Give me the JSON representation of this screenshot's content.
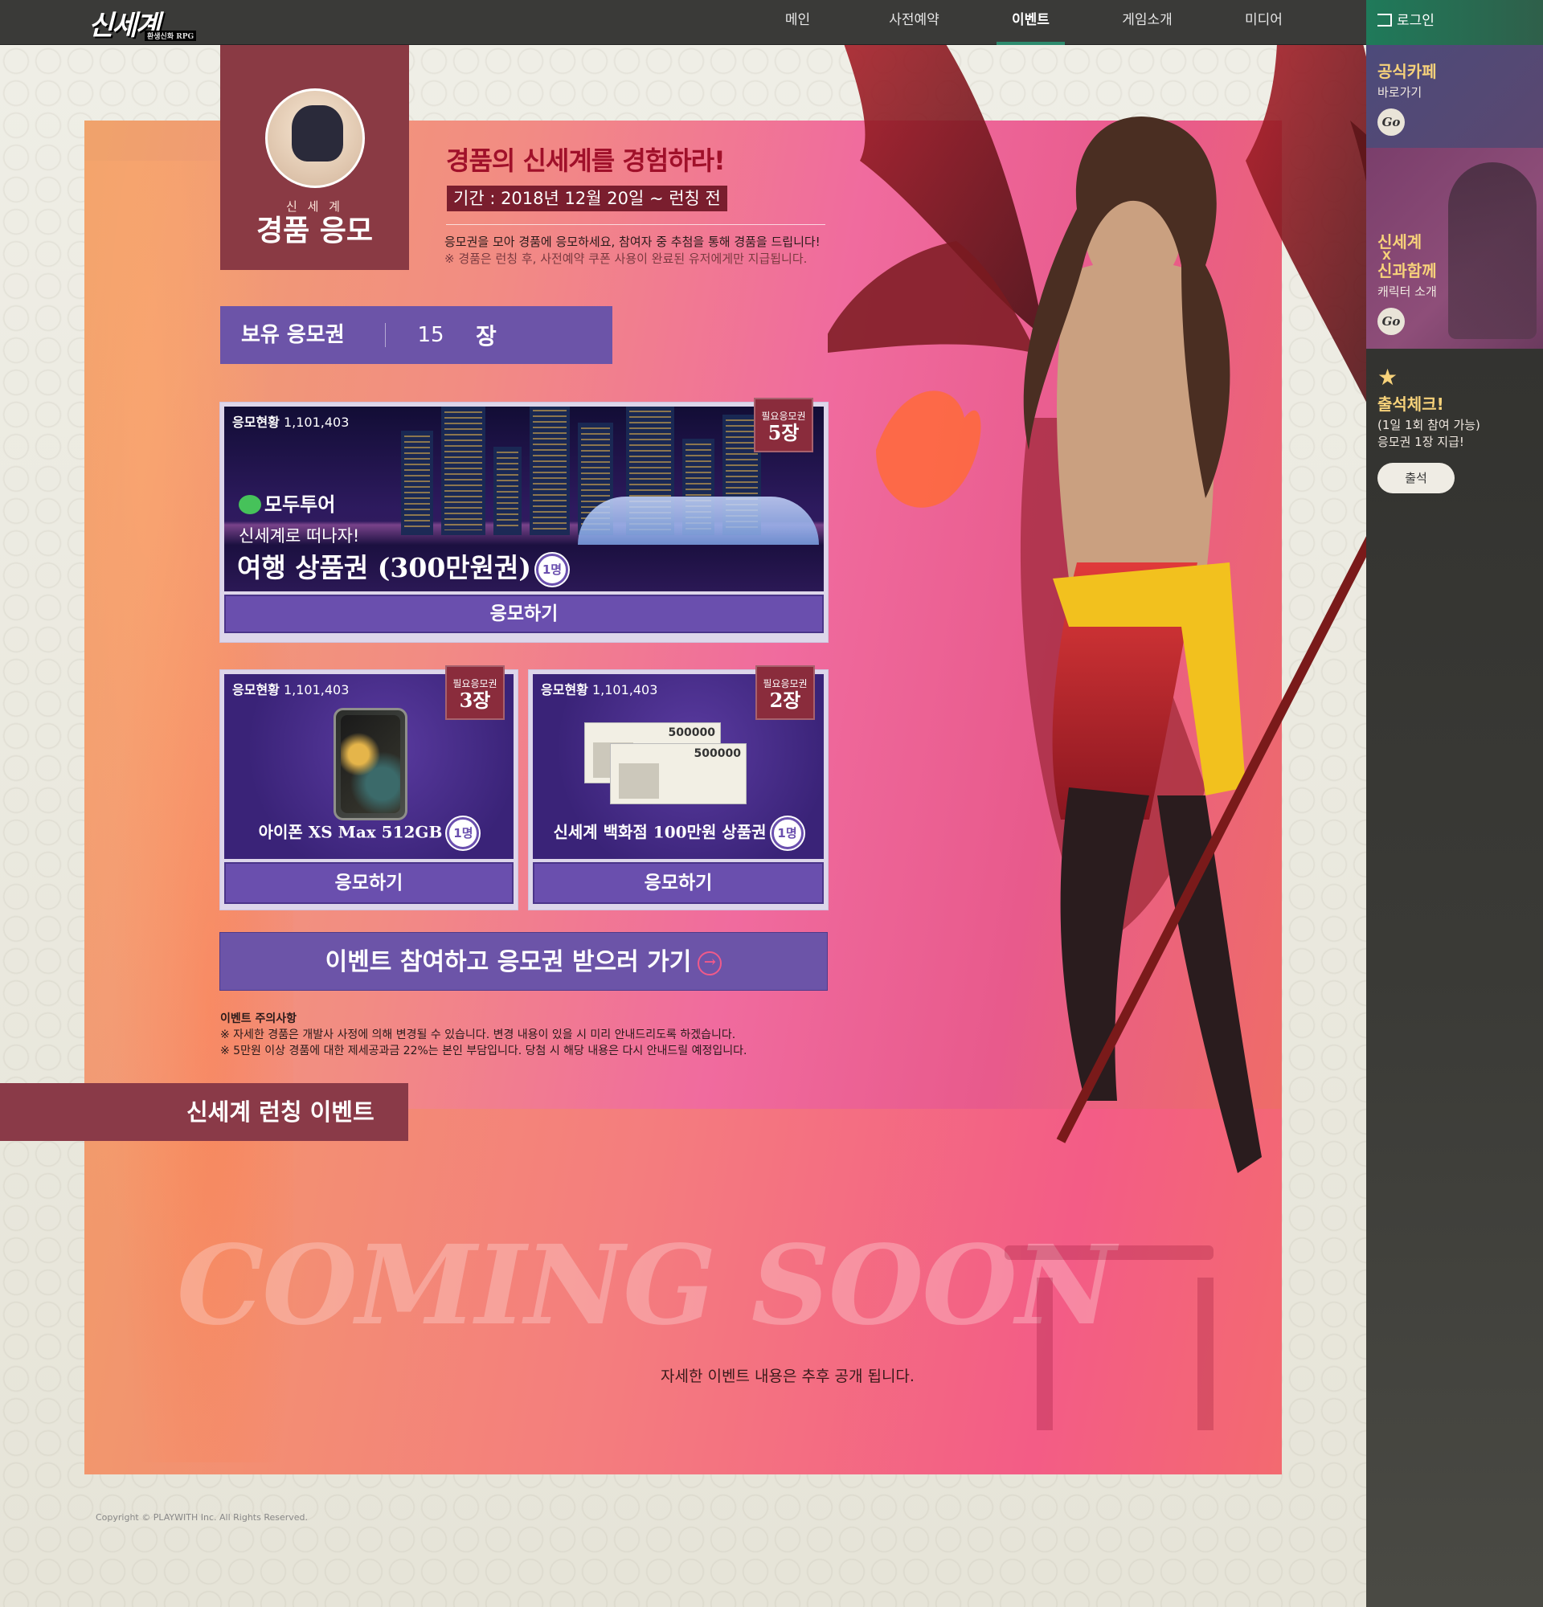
{
  "nav": {
    "logo": "신세계",
    "logo_sub": "환생신화 RPG",
    "items": [
      "메인",
      "사전예약",
      "이벤트",
      "게임소개",
      "미디어"
    ],
    "active": 2,
    "login": "로그인"
  },
  "side": {
    "cafe": {
      "title": "공식카페",
      "sub": "바로가기",
      "go": "Go"
    },
    "collab": {
      "title1": "신세계",
      "title2": "X",
      "title3": "신과함께",
      "sub": "캐릭터 소개",
      "go": "Go"
    },
    "attend": {
      "title": "출석체크!",
      "sub1": "(1일 1회 참여 가능)",
      "sub2": "응모권 1장 지급!",
      "button": "출석"
    }
  },
  "badge": {
    "small": "신 세 계",
    "big": "경품 응모"
  },
  "header": {
    "headline": "경품의 신세계를 경험하라!",
    "period": "기간 : 2018년 12월 20일 ~ 런칭 전",
    "intro": "응모권을 모아 경품에 응모하세요, 참여자 중 추첨을 통해 경품을 드립니다!",
    "note": "※ 경품은 런칭 후, 사전예약 쿠폰 사용이 완료된 유저에게만 지급됩니다."
  },
  "tickets": {
    "label": "보유 응모권",
    "count": "15",
    "unit": "장"
  },
  "prizes": [
    {
      "status_label": "응모현황",
      "status_value": "1,101,403",
      "req_label": "필요응모권",
      "req": "5장",
      "brand": "모두투어",
      "sub": "신세계로 떠나자!",
      "name": "여행 상품권 (300만원권)",
      "people": "1명",
      "apply": "응모하기"
    },
    {
      "status_label": "응모현황",
      "status_value": "1,101,403",
      "req_label": "필요응모권",
      "req": "3장",
      "name": "아이폰 XS Max 512GB",
      "people": "1명",
      "apply": "응모하기"
    },
    {
      "status_label": "응모현황",
      "status_value": "1,101,403",
      "req_label": "필요응모권",
      "req": "2장",
      "voucher": "500000",
      "name": "신세계 백화점 100만원 상품권",
      "people": "1명",
      "apply": "응모하기"
    }
  ],
  "go_event": "이벤트 참여하고 응모권 받으러 가기",
  "notice": {
    "title": "이벤트 주의사항",
    "line1": "※ 자세한 경품은 개발사 사정에 의해 변경될 수 있습니다. 변경 내용이 있을 시 미리 안내드리도록 하겠습니다.",
    "line2": "※ 5만원 이상 경품에 대한 제세공과금 22%는 본인 부담입니다. 당첨 시 해당 내용은 다시 안내드릴 예정입니다."
  },
  "launch": {
    "tab": "신세계 런칭 이벤트",
    "coming": "COMING SOON",
    "text": "자세한 이벤트 내용은 추후 공개 됩니다."
  },
  "copyright": "Copyright © PLAYWITH Inc. All Rights Reserved.",
  "colors": {
    "accent_purple": "#6c54a8",
    "accent_wine": "#8a3a44",
    "nav_bg": "#3a3a38",
    "login_green": "#1f7a5a"
  }
}
